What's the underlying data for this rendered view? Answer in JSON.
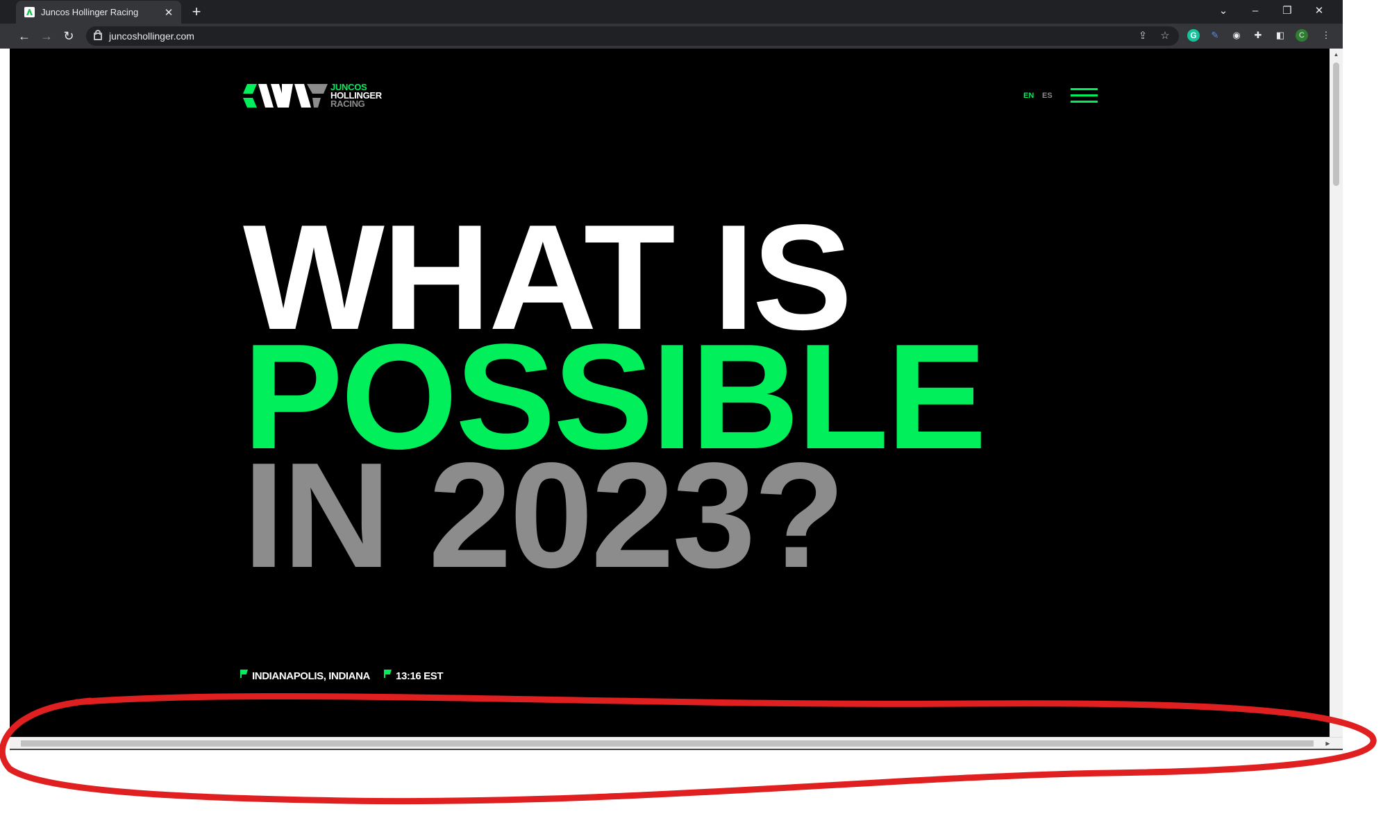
{
  "browser": {
    "tab_title": "Juncos Hollinger Racing",
    "tab_close": "✕",
    "new_tab": "+",
    "url": "juncoshollinger.com",
    "back": "←",
    "forward": "→",
    "reload": "↻",
    "window_controls": {
      "tablist": "⌄",
      "minimize": "–",
      "restore": "❐",
      "close": "✕"
    },
    "profile_initial": "C"
  },
  "site": {
    "logo": {
      "line1": "JUNCOS",
      "line2": "HOLLINGER",
      "line3": "RACING"
    },
    "languages": {
      "en": "EN",
      "es": "ES"
    },
    "headline": {
      "line1": "WHAT IS",
      "line2": "POSSIBLE",
      "line3": "IN 2023?"
    },
    "location": "INDIANAPOLIS, INDIANA",
    "time": "13:16 EST",
    "colors": {
      "accent": "#00ef5a",
      "background": "#000000",
      "muted": "#8c8c8c",
      "text": "#ffffff"
    }
  },
  "annotation": {
    "shape": "red-ellipse",
    "color": "#e02020"
  }
}
